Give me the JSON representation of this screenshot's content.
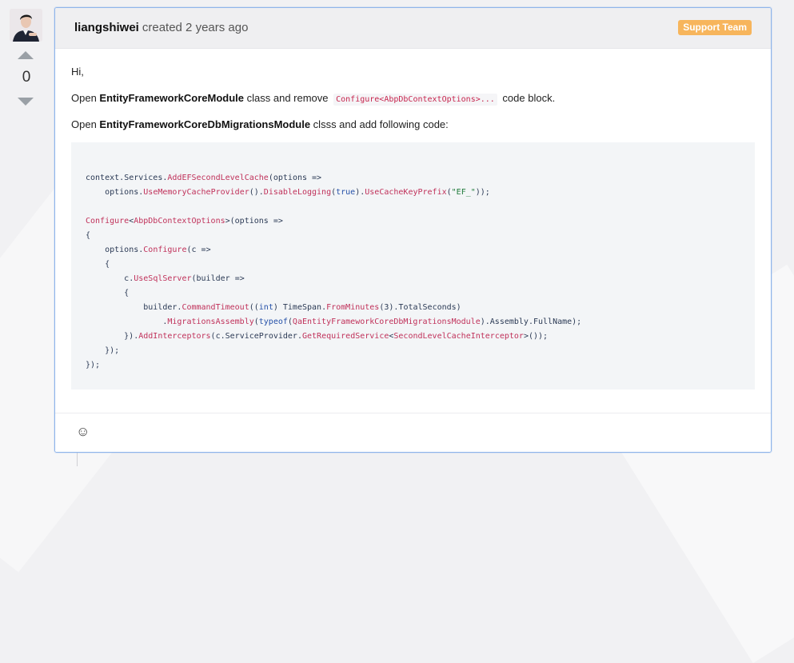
{
  "post": {
    "author": "liangshiwei",
    "meta": "created 2 years ago",
    "badge": "Support Team",
    "vote_count": "0"
  },
  "body": {
    "greeting": "Hi,",
    "line1_prefix": "Open ",
    "line1_bold": "EntityFrameworkCoreModule",
    "line1_mid": " class and remove ",
    "line1_code": "Configure<AbpDbContextOptions>...",
    "line1_suffix": " code block.",
    "line2_prefix": "Open ",
    "line2_bold": "EntityFrameworkCoreDbMigrationsModule",
    "line2_suffix": " clsss and add following code:"
  },
  "code_lines": [
    "context.Services.AddEFSecondLevelCache(options =>",
    "    options.UseMemoryCacheProvider().DisableLogging(true).UseCacheKeyPrefix(\"EF_\"));",
    "",
    "Configure<AbpDbContextOptions>(options =>",
    "{",
    "    options.Configure(c =>",
    "    {",
    "        c.UseSqlServer(builder =>",
    "        {",
    "            builder.CommandTimeout((int) TimeSpan.FromMinutes(3).TotalSeconds)",
    "                .MigrationsAssembly(typeof(QaEntityFrameworkCoreDbMigrationsModule).Assembly.FullName);",
    "        }).AddInterceptors(c.ServiceProvider.GetRequiredService<SecondLevelCacheInterceptor>());",
    "    });",
    "});"
  ],
  "icons": {
    "avatar": "avatar",
    "vote_up": "arrow-up-icon",
    "vote_down": "arrow-down-icon",
    "emoji": "smiley-icon"
  },
  "colors": {
    "badge": "#f7b55c",
    "card_border": "#8fb5ea"
  }
}
